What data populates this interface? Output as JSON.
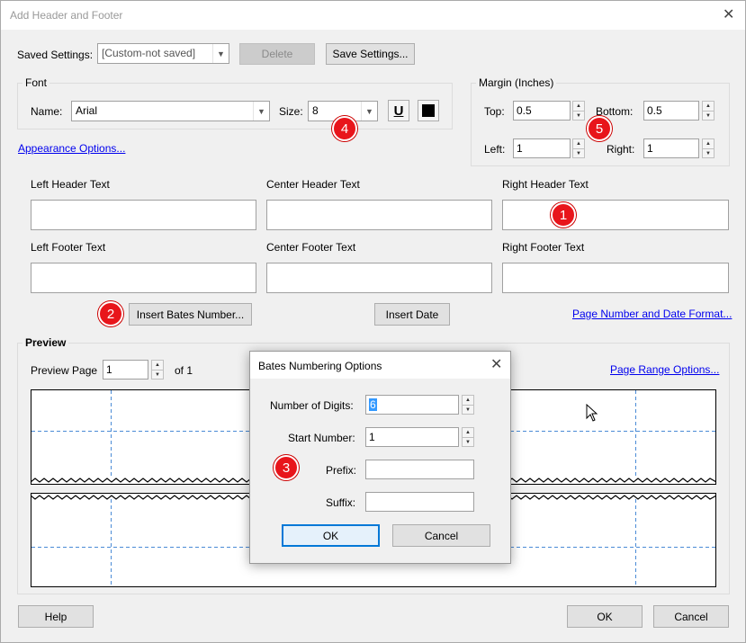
{
  "window": {
    "title": "Add Header and Footer"
  },
  "saved_settings": {
    "label": "Saved Settings:",
    "value": "[Custom-not saved]",
    "delete_label": "Delete",
    "save_label": "Save Settings..."
  },
  "font": {
    "group_title": "Font",
    "name_label": "Name:",
    "name_value": "Arial",
    "size_label": "Size:",
    "size_value": "8",
    "underline_glyph": "U"
  },
  "margin": {
    "group_title": "Margin (Inches)",
    "top_label": "Top:",
    "top_value": "0.5",
    "bottom_label": "Bottom:",
    "bottom_value": "0.5",
    "left_label": "Left:",
    "left_value": "1",
    "right_label": "Right:",
    "right_value": "1"
  },
  "appearance_link": "Appearance Options...",
  "header_text": {
    "left": "Left Header Text",
    "center": "Center Header Text",
    "right": "Right Header Text"
  },
  "footer_text": {
    "left": "Left Footer Text",
    "center": "Center Footer Text",
    "right": "Right Footer Text"
  },
  "insert_bates_label": "Insert Bates Number...",
  "insert_date_label": "Insert Date",
  "page_number_format_link": "Page Number and Date Format...",
  "preview": {
    "group_title": "Preview",
    "page_label": "Preview Page",
    "page_value": "1",
    "of_label": "of 1",
    "page_range_link": "Page Range Options..."
  },
  "footer_buttons": {
    "help": "Help",
    "ok": "OK",
    "cancel": "Cancel"
  },
  "bates_dialog": {
    "title": "Bates Numbering Options",
    "digits_label": "Number of Digits:",
    "digits_value": "6",
    "start_label": "Start Number:",
    "start_value": "1",
    "prefix_label": "Prefix:",
    "prefix_value": "",
    "suffix_label": "Suffix:",
    "suffix_value": "",
    "ok_label": "OK",
    "cancel_label": "Cancel"
  },
  "badges": [
    "1",
    "2",
    "3",
    "4",
    "5"
  ],
  "colors": {
    "accent": "#0078d7",
    "badge": "#e8151b",
    "link": "#0000ee",
    "guide": "#4a8bd6"
  }
}
